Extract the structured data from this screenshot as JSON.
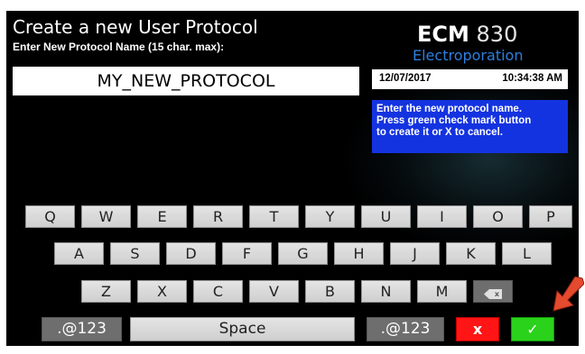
{
  "header": {
    "title": "Create a new User Protocol",
    "subtitle": "Enter New Protocol Name (15 char. max):",
    "name_value": "MY_NEW_PROTOCOL"
  },
  "brand": {
    "model_bold": "ECM",
    "model_num": "830",
    "product": "Electroporation",
    "accent": "#2d7fe0"
  },
  "status": {
    "date": "12/07/2017",
    "time": "10:34:38 AM"
  },
  "info": {
    "lines": [
      "Enter the new protocol name.",
      "Press green check mark button",
      "to create it or X to cancel."
    ],
    "bg_color": "#1433e0"
  },
  "keyboard": {
    "row1": [
      "Q",
      "W",
      "E",
      "R",
      "T",
      "Y",
      "U",
      "I",
      "O",
      "P"
    ],
    "row2": [
      "A",
      "S",
      "D",
      "F",
      "G",
      "H",
      "J",
      "K",
      "L"
    ],
    "row3": [
      "Z",
      "X",
      "C",
      "V",
      "B",
      "N",
      "M"
    ],
    "backspace_glyph": "x",
    "symbols_left": ".@123",
    "space": "Space",
    "symbols_right": ".@123",
    "cancel_glyph": "x",
    "confirm_glyph": "✓",
    "cancel_color": "#ff1515",
    "confirm_color": "#2bd21b"
  }
}
